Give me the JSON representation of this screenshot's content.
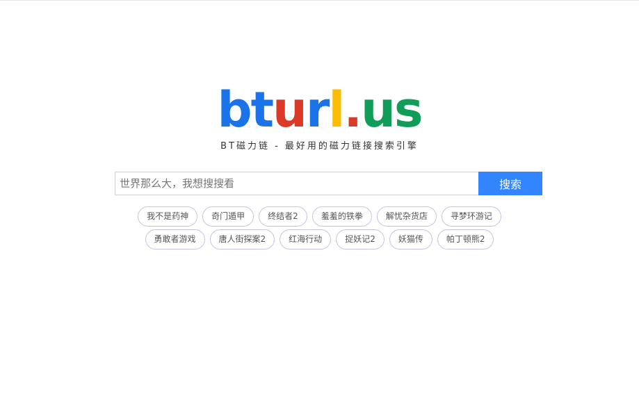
{
  "logo": {
    "letters": [
      {
        "char": "b",
        "color": "#1a73e8"
      },
      {
        "char": "t",
        "color": "#1a73e8"
      },
      {
        "char": "u",
        "color": "#db3a28"
      },
      {
        "char": "r",
        "color": "#1a73e8"
      },
      {
        "char": "l",
        "color": "#fbbc05"
      },
      {
        "char": ".",
        "color": "#db3a28"
      },
      {
        "char": "u",
        "color": "#0f9d58"
      },
      {
        "char": "s",
        "color": "#0f9d58"
      }
    ]
  },
  "tagline": "BT磁力链 - 最好用的磁力链接搜索引擎",
  "search": {
    "placeholder": "世界那么大，我想搜搜看",
    "value": "",
    "button_label": "搜索",
    "button_color": "#3385ff"
  },
  "hot_tags": {
    "row1": [
      "我不是药神",
      "奇门遁甲",
      "终结者2",
      "羞羞的铁拳",
      "解忧杂货店",
      "寻梦环游记"
    ],
    "row2": [
      "勇敢者游戏",
      "唐人街探案2",
      "红海行动",
      "捉妖记2",
      "妖猫传",
      "帕丁顿熊2"
    ]
  }
}
